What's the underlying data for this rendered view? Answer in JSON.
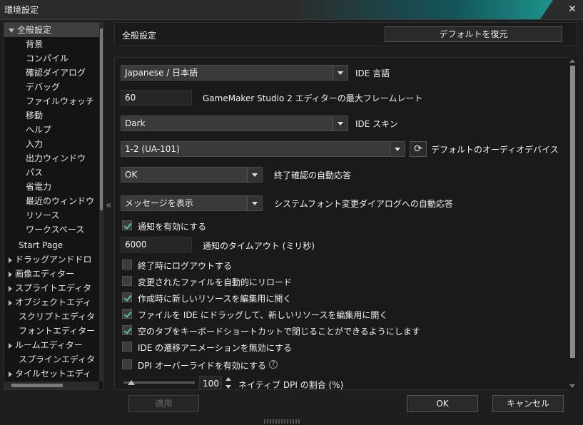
{
  "window": {
    "title": "環境設定",
    "close_glyph": "✕"
  },
  "tree": {
    "items": [
      {
        "label": "全般設定",
        "level": 0,
        "expand": "down",
        "selected": true
      },
      {
        "label": "背景",
        "level": 1
      },
      {
        "label": "コンパイル",
        "level": 1
      },
      {
        "label": "確認ダイアログ",
        "level": 1
      },
      {
        "label": "デバッグ",
        "level": 1
      },
      {
        "label": "ファイルウォッチ",
        "level": 1
      },
      {
        "label": "移動",
        "level": 1
      },
      {
        "label": "ヘルプ",
        "level": 1
      },
      {
        "label": "入力",
        "level": 1
      },
      {
        "label": "出力ウィンドウ",
        "level": 1
      },
      {
        "label": "パス",
        "level": 1
      },
      {
        "label": "省電力",
        "level": 1
      },
      {
        "label": "最近のウィンドウ",
        "level": 1
      },
      {
        "label": "リソース",
        "level": 1
      },
      {
        "label": "ワークスペース",
        "level": 1
      },
      {
        "label": "Start Page",
        "level": 0
      },
      {
        "label": "ドラッグアンドドロ",
        "level": 0,
        "expand": "right"
      },
      {
        "label": "画像エディター",
        "level": 0,
        "expand": "right"
      },
      {
        "label": "スプライトエディタ",
        "level": 0,
        "expand": "right"
      },
      {
        "label": "オブジェクトエディ",
        "level": 0,
        "expand": "right"
      },
      {
        "label": "スクリプトエディタ",
        "level": 0
      },
      {
        "label": "フォントエディター",
        "level": 0
      },
      {
        "label": "ルームエディター",
        "level": 0,
        "expand": "right"
      },
      {
        "label": "スプラインエディタ",
        "level": 0
      },
      {
        "label": "タイルセットエディ",
        "level": 0,
        "expand": "right"
      }
    ],
    "collapse_glyph": "«"
  },
  "header": {
    "title": "全般設定",
    "restore_default_label": "デフォルトを復元"
  },
  "settings": {
    "ide_language": {
      "value": "Japanese / 日本語",
      "label": "IDE 言語"
    },
    "max_framerate": {
      "value": "60",
      "label": "GameMaker Studio 2 エディターの最大フレームレート"
    },
    "ide_skin": {
      "value": "Dark",
      "label": "IDE スキン"
    },
    "audio_device": {
      "value": "1-2 (UA-101)",
      "label": "デフォルトのオーディオデバイス",
      "refresh_glyph": "⟳"
    },
    "exit_confirm": {
      "value": "OK",
      "label": "終了確認の自動応答"
    },
    "system_font": {
      "value": "メッセージを表示",
      "label": "システムフォント変更ダイアログへの自動応答"
    },
    "enable_notifications": {
      "label": "通知を有効にする",
      "checked": true
    },
    "notification_timeout": {
      "value": "6000",
      "label": "通知のタイムアウト (ミリ秒)"
    },
    "logout_on_exit": {
      "label": "終了時にログアウトする",
      "checked": false
    },
    "auto_reload": {
      "label": "変更されたファイルを自動的にリロード",
      "checked": false
    },
    "open_new_for_edit": {
      "label": "作成時に新しいリソースを編集用に開く",
      "checked": true
    },
    "drag_file_open": {
      "label": "ファイルを IDE にドラッグして、新しいリソースを編集用に開く",
      "checked": true
    },
    "close_empty_tabs": {
      "label": "空のタブをキーボードショートカットで閉じることができるようにします",
      "checked": true
    },
    "disable_transition": {
      "label": "IDE の遷移アニメーションを無効にする",
      "checked": false
    },
    "dpi_override": {
      "label": "DPI オーバーライドを有効にする",
      "checked": false,
      "help_glyph": "?"
    },
    "native_dpi": {
      "value": "100",
      "label": "ネイティブ DPI の割合 (%)",
      "slider_fraction": 0.0
    }
  },
  "footer": {
    "apply_label": "適用",
    "ok_label": "OK",
    "cancel_label": "キャンセル"
  },
  "colors": {
    "check_accent": "#4ec9a5",
    "title_accent": "#1ea89a"
  }
}
